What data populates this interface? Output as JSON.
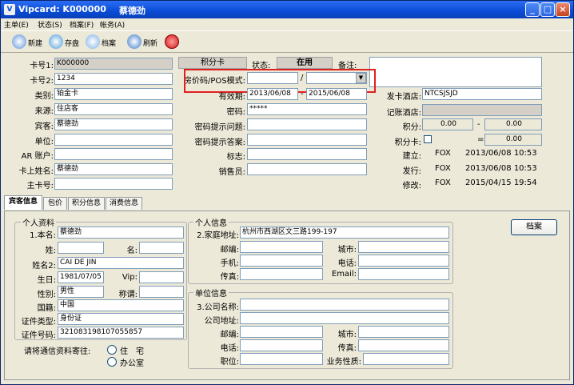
{
  "title": {
    "app": "Vipcard: K000000",
    "guest": "蔡德劲"
  },
  "menu": [
    "主单(E)",
    "状态(S)",
    "档案(F)",
    "帐务(A)"
  ],
  "toolbar": {
    "new": "新建",
    "save": "存盘",
    "archive": "档案",
    "refresh": "刷新"
  },
  "card": {
    "no1_label": "卡号1:",
    "no1": "K000000",
    "no2_label": "卡号2:",
    "no2": "1234",
    "type_label": "类别:",
    "type": "铂金卡",
    "source_label": "来源:",
    "source": "住店客",
    "guest_label": "宾客:",
    "guest": "蔡德劲",
    "unit_label": "单位:",
    "unit": "",
    "ar_label": "AR 账户:",
    "ar": "",
    "card_name_label": "卡上姓名:",
    "card_name": "蔡德劲",
    "main_card_label": "主卡号:",
    "main_card": ""
  },
  "mid": {
    "points_card": "积分卡",
    "status_label": "状态:",
    "status": "在用",
    "remark_label": "备注:",
    "remark": "",
    "pos_label": "房价码/POS模式:",
    "pos_sep": "/",
    "valid_label": "有效期:",
    "valid_from": "2013/06/08",
    "valid_to": "2015/06/08",
    "valid_sep": "-",
    "password_label": "密码:",
    "password": "*****",
    "question_label": "密码提示问题:",
    "answer_label": "密码提示答案:",
    "flag_label": "标志:",
    "sales_label": "销售员:"
  },
  "right": {
    "issue_hotel_label": "发卡酒店:",
    "issue_hotel": "NTCSJSJD",
    "acct_hotel_label": "记账酒店:",
    "points_label": "积分:",
    "points": "0.00",
    "points_sep": "-",
    "points2": "0.00",
    "points_card_label": "积分卡:",
    "eq": "=",
    "points3": "0.00",
    "created_label": "建立:",
    "created_by": "FOX",
    "created_at": "2013/06/08 10:53",
    "issued_label": "发行:",
    "issued_by": "FOX",
    "issued_at": "2013/06/08 10:53",
    "modified_label": "修改:",
    "modified_by": "FOX",
    "modified_at": "2015/04/15 19:54"
  },
  "tabs": [
    "宾客信息",
    "包价",
    "积分信息",
    "消费信息"
  ],
  "personal": {
    "group": "个人资料",
    "name_label": "1.本名:",
    "name": "蔡德劲",
    "surname_label": "姓:",
    "given_label": "名:",
    "name2_label": "姓名2:",
    "name2": "CAI DE JIN",
    "birth_label": "生日:",
    "birth": "1981/07/05",
    "vip_label": "Vip:",
    "gender_label": "性别:",
    "gender": "男性",
    "title_label": "称谓:",
    "nation_label": "国籍:",
    "nation": "中国",
    "id_type_label": "证件类型:",
    "id_type": "身份证",
    "id_no_label": "证件号码:",
    "id_no": "321083198107055857",
    "mail_to": "请将通信资料寄往:",
    "opt_home": "住　宅",
    "opt_office": "办公室"
  },
  "personal_info": {
    "group": "个人信息",
    "home_label": "2.家庭地址:",
    "home": "杭州市西湖区文三路199-197",
    "zip_label": "邮编:",
    "city_label": "城市:",
    "mobile_label": "手机:",
    "phone_label": "电话:",
    "fax_label": "传真:",
    "email_label": "Email:"
  },
  "company": {
    "group": "单位信息",
    "name_label": "3.公司名称:",
    "addr_label": "公司地址:",
    "zip_label": "邮编:",
    "city_label": "城市:",
    "phone_label": "电话:",
    "fax_label": "传真:",
    "position_label": "职位:",
    "biz_label": "业务性质:"
  },
  "archive_button": "档案"
}
